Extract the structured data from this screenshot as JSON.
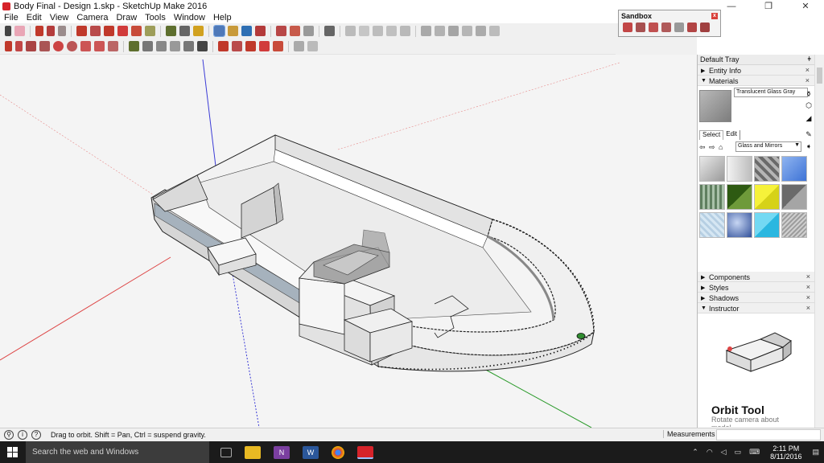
{
  "window": {
    "title": "Body Final - Design 1.skp - SketchUp Make 2016",
    "minimize": "—",
    "maximize": "❐",
    "close": "✕"
  },
  "menu": [
    "File",
    "Edit",
    "View",
    "Camera",
    "Draw",
    "Tools",
    "Window",
    "Help"
  ],
  "sandbox": {
    "title": "Sandbox",
    "close": "x"
  },
  "tray": {
    "title": "Default Tray",
    "pin": "ǂ",
    "panels": {
      "entity_info": "Entity Info",
      "materials": "Materials",
      "components": "Components",
      "styles": "Styles",
      "shadows": "Shadows",
      "instructor": "Instructor"
    },
    "material_name": "Translucent Glass Gray",
    "tab_select": "Select",
    "tab_edit": "Edit",
    "library": "Glass and Mirrors",
    "swatches": [
      "#c9c9c9",
      "#d8d8d8",
      "#8a8a8a",
      "#5d8fe0",
      "#6f8f6f",
      "#3d6b1f",
      "#f2ee2a",
      "#8e8e8e",
      "#cfe3f1",
      "#4d6fb8",
      "#47c8ea",
      "#b8b8b8"
    ],
    "instructor_title": "Orbit Tool",
    "instructor_desc": "Rotate camera about model."
  },
  "status": {
    "text": "Drag to orbit. Shift = Pan, Ctrl = suspend gravity.",
    "measurements_label": "Measurements",
    "measurements_value": ""
  },
  "taskbar": {
    "search_placeholder": "Search the web and Windows",
    "time": "2:11 PM",
    "date": "8/11/2016"
  },
  "colors": {
    "viewport_bg": "#f4f4f4",
    "hull_stripe": "#a6b2bd",
    "taskbar_bg": "#1b1b1b",
    "sketchup_red": "#d6232a"
  }
}
